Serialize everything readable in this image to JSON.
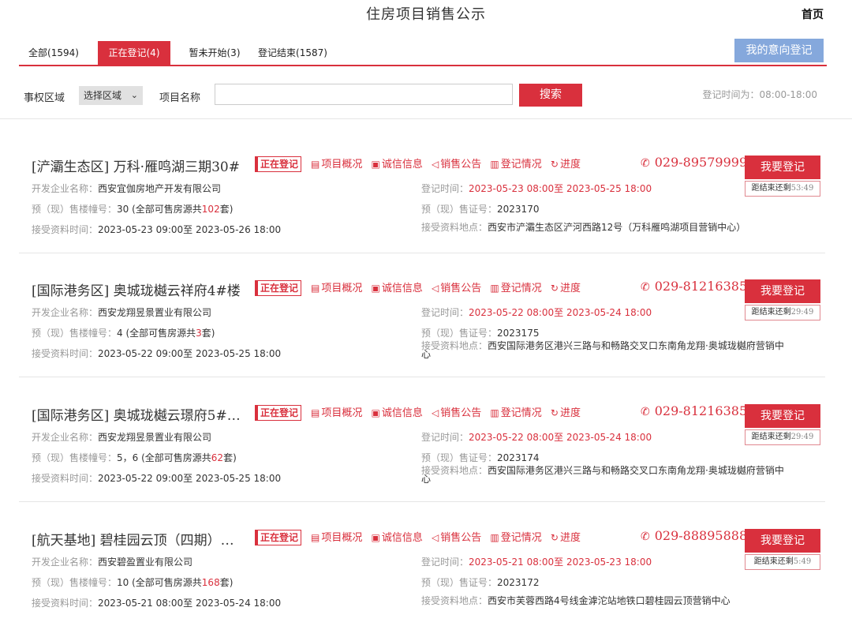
{
  "header": {
    "title": "住房项目销售公示",
    "home": "首页"
  },
  "tabs": [
    {
      "label": "全部(1594)",
      "active": false
    },
    {
      "label": "正在登记(4)",
      "active": true
    },
    {
      "label": "暂未开始(3)",
      "active": false
    },
    {
      "label": "登记结束(1587)",
      "active": false
    }
  ],
  "intent_button": "我的意向登记",
  "filter": {
    "region_label": "事权区域",
    "region_select": "选择区域",
    "name_label": "项目名称",
    "name_value": "",
    "search_button": "搜索",
    "hours": "登记时间为：08:00-18:00"
  },
  "labels": {
    "developer": "开发企业名称：",
    "buildings": "预（现）售楼幢号：",
    "accept_time": "接受资料时间：",
    "reg_time": "登记时间：",
    "cert": "预（现）售证号：",
    "accept_place": "接受资料地点：",
    "status_badge": "正在登记",
    "link_overview": "项目概况",
    "link_credit": "诚信信息",
    "link_notice": "销售公告",
    "link_reg": "登记情况",
    "link_progress": "进度",
    "register_button": "我要登记",
    "countdown_prefix": "距结束还剩"
  },
  "projects": [
    {
      "title": "[浐灞生态区] 万科·雁鸣湖三期30#",
      "phone": "029-89579999",
      "countdown": "53:49",
      "developer": "西安宜伽房地产开发有限公司",
      "reg_time": "2023-05-23 08:00至 2023-05-25 18:00",
      "buildings_pre": "30 (全部可售房源共",
      "buildings_num": "102",
      "buildings_post": "套)",
      "cert": "2023170",
      "accept_time": "2023-05-23 09:00至 2023-05-26 18:00",
      "accept_place": "西安市浐灞生态区浐河西路12号（万科雁鸣湖项目营销中心）"
    },
    {
      "title": "[国际港务区] 奥城珑樾云祥府4#楼",
      "phone": "029-81216385",
      "countdown": "29:49",
      "developer": "西安龙翔昱景置业有限公司",
      "reg_time": "2023-05-22 08:00至 2023-05-24 18:00",
      "buildings_pre": "4 (全部可售房源共",
      "buildings_num": "3",
      "buildings_post": "套)",
      "cert": "2023175",
      "accept_time": "2023-05-22 09:00至 2023-05-25 18:00",
      "accept_place": "西安国际港务区港兴三路与和畅路交叉口东南角龙翔·奥城珑樾府营销中心"
    },
    {
      "title": "[国际港务区] 奥城珑樾云璟府5#…",
      "phone": "029-81216385",
      "countdown": "29:49",
      "developer": "西安龙翔昱景置业有限公司",
      "reg_time": "2023-05-22 08:00至 2023-05-24 18:00",
      "buildings_pre": "5，6 (全部可售房源共",
      "buildings_num": "62",
      "buildings_post": "套)",
      "cert": "2023174",
      "accept_time": "2023-05-22 09:00至 2023-05-25 18:00",
      "accept_place": "西安国际港务区港兴三路与和畅路交叉口东南角龙翔·奥城珑樾府营销中心"
    },
    {
      "title": "[航天基地] 碧桂园云顶（四期）…",
      "phone": "029-88895888",
      "countdown": "5:49",
      "developer": "西安碧盈置业有限公司",
      "reg_time": "2023-05-21 08:00至 2023-05-23 18:00",
      "buildings_pre": "10 (全部可售房源共",
      "buildings_num": "168",
      "buildings_post": "套)",
      "cert": "2023172",
      "accept_time": "2023-05-21 08:00至 2023-05-24 18:00",
      "accept_place": "西安市芙蓉西路4号线金滹沱站地铁口碧桂园云顶营销中心"
    }
  ]
}
